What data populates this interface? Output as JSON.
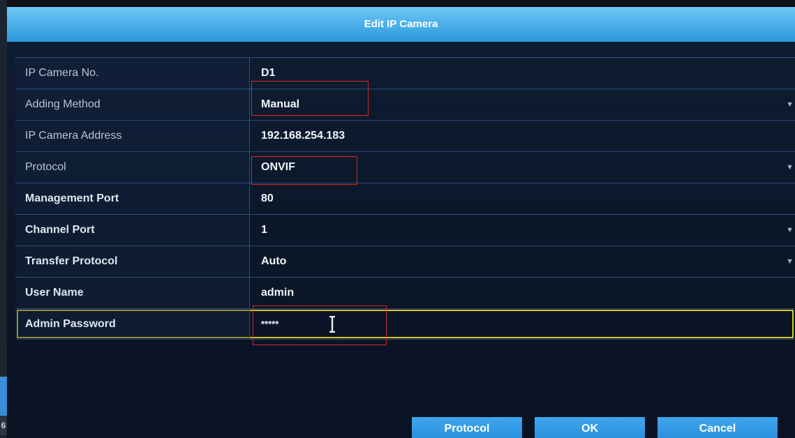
{
  "dialog": {
    "title": "Edit IP Camera"
  },
  "fields": [
    {
      "label": "IP Camera No.",
      "value": "D1",
      "dropdown": false
    },
    {
      "label": "Adding Method",
      "value": "Manual",
      "dropdown": true
    },
    {
      "label": "IP Camera Address",
      "value": "192.168.254.183",
      "dropdown": false
    },
    {
      "label": "Protocol",
      "value": "ONVIF",
      "dropdown": true
    },
    {
      "label": "Management Port",
      "value": "80",
      "dropdown": false
    },
    {
      "label": "Channel Port",
      "value": "1",
      "dropdown": true
    },
    {
      "label": "Transfer Protocol",
      "value": "Auto",
      "dropdown": true
    },
    {
      "label": "User Name",
      "value": "admin",
      "dropdown": false
    },
    {
      "label": "Admin Password",
      "value": "*****",
      "dropdown": false
    }
  ],
  "buttons": {
    "protocol": "Protocol",
    "ok": "OK",
    "cancel": "Cancel"
  },
  "sidebar": {
    "page_number": "6"
  },
  "icons": {
    "dropdown": "chevron-down-icon",
    "text_cursor": "text-cursor-icon"
  },
  "colors": {
    "title_bar": "#48aee8",
    "button": "#2a8fdc",
    "focus_outline": "#d9c828",
    "annotation": "#d32a2a"
  }
}
